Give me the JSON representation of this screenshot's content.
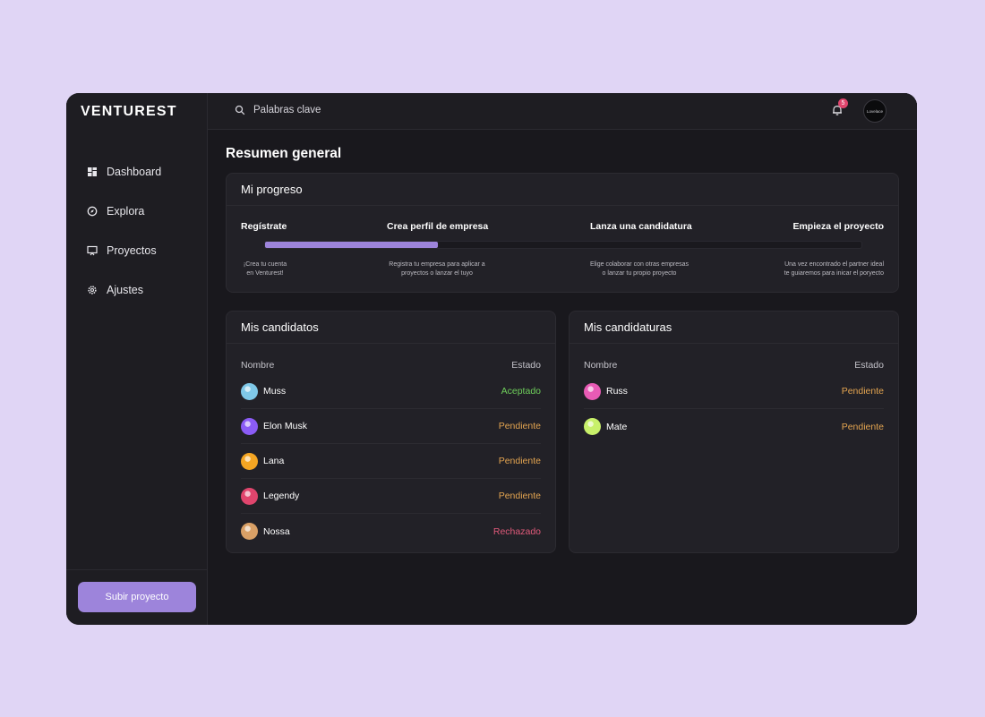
{
  "brand": {
    "name": "VENTUREST"
  },
  "sidebar": {
    "items": [
      {
        "label": "Dashboard",
        "icon": "dashboard-icon"
      },
      {
        "label": "Explora",
        "icon": "compass-icon"
      },
      {
        "label": "Proyectos",
        "icon": "presentation-icon"
      },
      {
        "label": "Ajustes",
        "icon": "gear-icon"
      }
    ],
    "upload_button": "Subir proyecto"
  },
  "topbar": {
    "search_placeholder": "Palabras clave",
    "notification_count": "5",
    "avatar_text": "Lovelace"
  },
  "page": {
    "title": "Resumen general"
  },
  "progress": {
    "title": "Mi progreso",
    "completion": 0.29,
    "steps": [
      {
        "title": "Regístrate",
        "desc_line1": "¡Crea tu cuenta",
        "desc_line2": "en Venturest!"
      },
      {
        "title": "Crea perfil de empresa",
        "desc_line1": "Registra tu empresa para aplicar a",
        "desc_line2": "proyectos o lanzar el tuyo"
      },
      {
        "title": "Lanza una candidatura",
        "desc_line1": "Elige colaborar con otras empresas",
        "desc_line2": "o lanzar tu propio proyecto"
      },
      {
        "title": "Empieza el proyecto",
        "desc_line1": "Una vez encontrado el partner ideal",
        "desc_line2": "te guiaremos para inicar el poryecto"
      }
    ]
  },
  "candidates": {
    "title": "Mis candidatos",
    "col_name": "Nombre",
    "col_status": "Estado",
    "rows": [
      {
        "name": "Muss",
        "status": "Aceptado",
        "status_color": "#6fcf5b",
        "avatar_color": "#7fc8e8"
      },
      {
        "name": "Elon Musk",
        "status": "Pendiente",
        "status_color": "#e3a450",
        "avatar_color": "#8b5cf6"
      },
      {
        "name": "Lana",
        "status": "Pendiente",
        "status_color": "#e3a450",
        "avatar_color": "#f5a623"
      },
      {
        "name": "Legendy",
        "status": "Pendiente",
        "status_color": "#e3a450",
        "avatar_color": "#e0456d"
      },
      {
        "name": "Nossa",
        "status": "Rechazado",
        "status_color": "#e05a7a",
        "avatar_color": "#d9a066"
      }
    ]
  },
  "applications": {
    "title": "Mis candidaturas",
    "col_name": "Nombre",
    "col_status": "Estado",
    "rows": [
      {
        "name": "Russ",
        "status": "Pendiente",
        "status_color": "#e3a450",
        "avatar_color": "#e85bb5"
      },
      {
        "name": "Mate",
        "status": "Pendiente",
        "status_color": "#e3a450",
        "avatar_color": "#c8f06a"
      }
    ]
  },
  "colors": {
    "accent": "#9d84db",
    "background": "#e0d5f5",
    "panel": "#1e1d22"
  }
}
